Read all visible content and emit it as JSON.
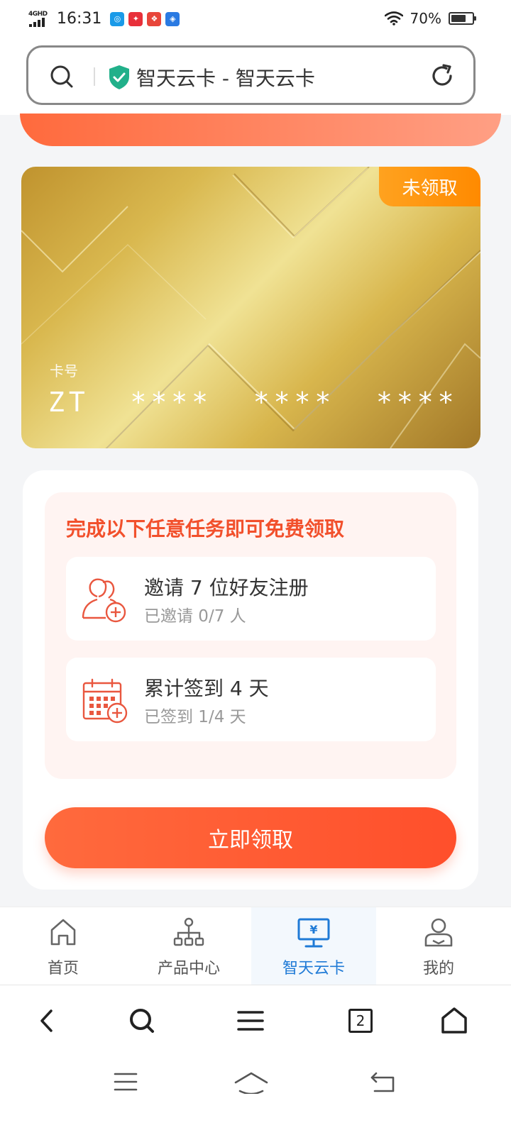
{
  "status_bar": {
    "network": "4GHD",
    "time": "16:31",
    "battery": "70%",
    "battery_level": 0.7,
    "notification_icons": [
      {
        "name": "app-notification-icon-1",
        "color": "#1a9ae8",
        "glyph": "◎"
      },
      {
        "name": "app-notification-icon-2",
        "color": "#e8303a",
        "glyph": "✦"
      },
      {
        "name": "app-notification-icon-3",
        "color": "#e8453a",
        "glyph": "❖"
      },
      {
        "name": "app-notification-icon-4",
        "color": "#2a7ae2",
        "glyph": "◈"
      }
    ]
  },
  "address_bar": {
    "title": "智天云卡 - 智天云卡"
  },
  "card": {
    "badge": "未领取",
    "number_label": "卡号",
    "number": "ZT  ****  ****  ****"
  },
  "tasks": {
    "heading": "完成以下任意任务即可免费领取",
    "items": [
      {
        "title": "邀请 7 位好友注册",
        "subtitle": "已邀请 0/7 人",
        "icon": "invite-friends-icon"
      },
      {
        "title": "累计签到 4 天",
        "subtitle": "已签到 1/4 天",
        "icon": "calendar-checkin-icon"
      }
    ],
    "claim_button": "立即领取"
  },
  "tab_bar": {
    "active_index": 2,
    "accent_color": "#1f7ad6",
    "items": [
      {
        "label": "首页",
        "icon": "home-icon"
      },
      {
        "label": "产品中心",
        "icon": "org-chart-icon"
      },
      {
        "label": "智天云卡",
        "icon": "monitor-yuan-icon"
      },
      {
        "label": "我的",
        "icon": "user-profile-icon"
      }
    ]
  },
  "browser_toolbar": {
    "tab_count": "2"
  },
  "colors": {
    "accent_orange": "#ff5a34",
    "badge_orange": "#ff8a00",
    "heading_red": "#f2502c"
  }
}
